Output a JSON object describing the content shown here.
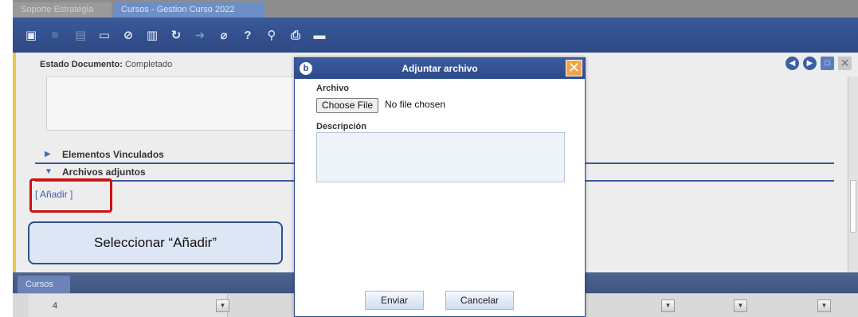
{
  "tabs": [
    "Soporte Estrategia",
    "Cursos - Gestion Curso 2022"
  ],
  "toolbar_icons": [
    "new-doc-icon",
    "list-icon",
    "save-icon",
    "new-record-icon",
    "cancel-icon",
    "delete-icon",
    "refresh-icon",
    "export-icon",
    "attach-icon",
    "help-icon",
    "link-icon",
    "print-icon",
    "window-icon"
  ],
  "doc": {
    "estado_label": "Estado Documento:",
    "estado_value": "Completado",
    "section1": "Elementos Vinculados",
    "section2": "Archivos adjuntos",
    "anadir": "[ Añadir ]"
  },
  "bottom": {
    "tab": "Cursos",
    "row_number": "4"
  },
  "modal": {
    "title": "Adjuntar archivo",
    "archivo_label": "Archivo",
    "choose_file": "Choose File",
    "no_file": "No file chosen",
    "descripcion_label": "Descripción",
    "enviar": "Enviar",
    "cancelar": "Cancelar"
  },
  "callout": "Seleccionar “Añadir”",
  "colors": {
    "toolbar": "#3a5997",
    "modal_title": "#2c4a8a",
    "close": "#f0a34a",
    "highlight": "#cc1111",
    "callout_bg": "#dce6f5"
  }
}
